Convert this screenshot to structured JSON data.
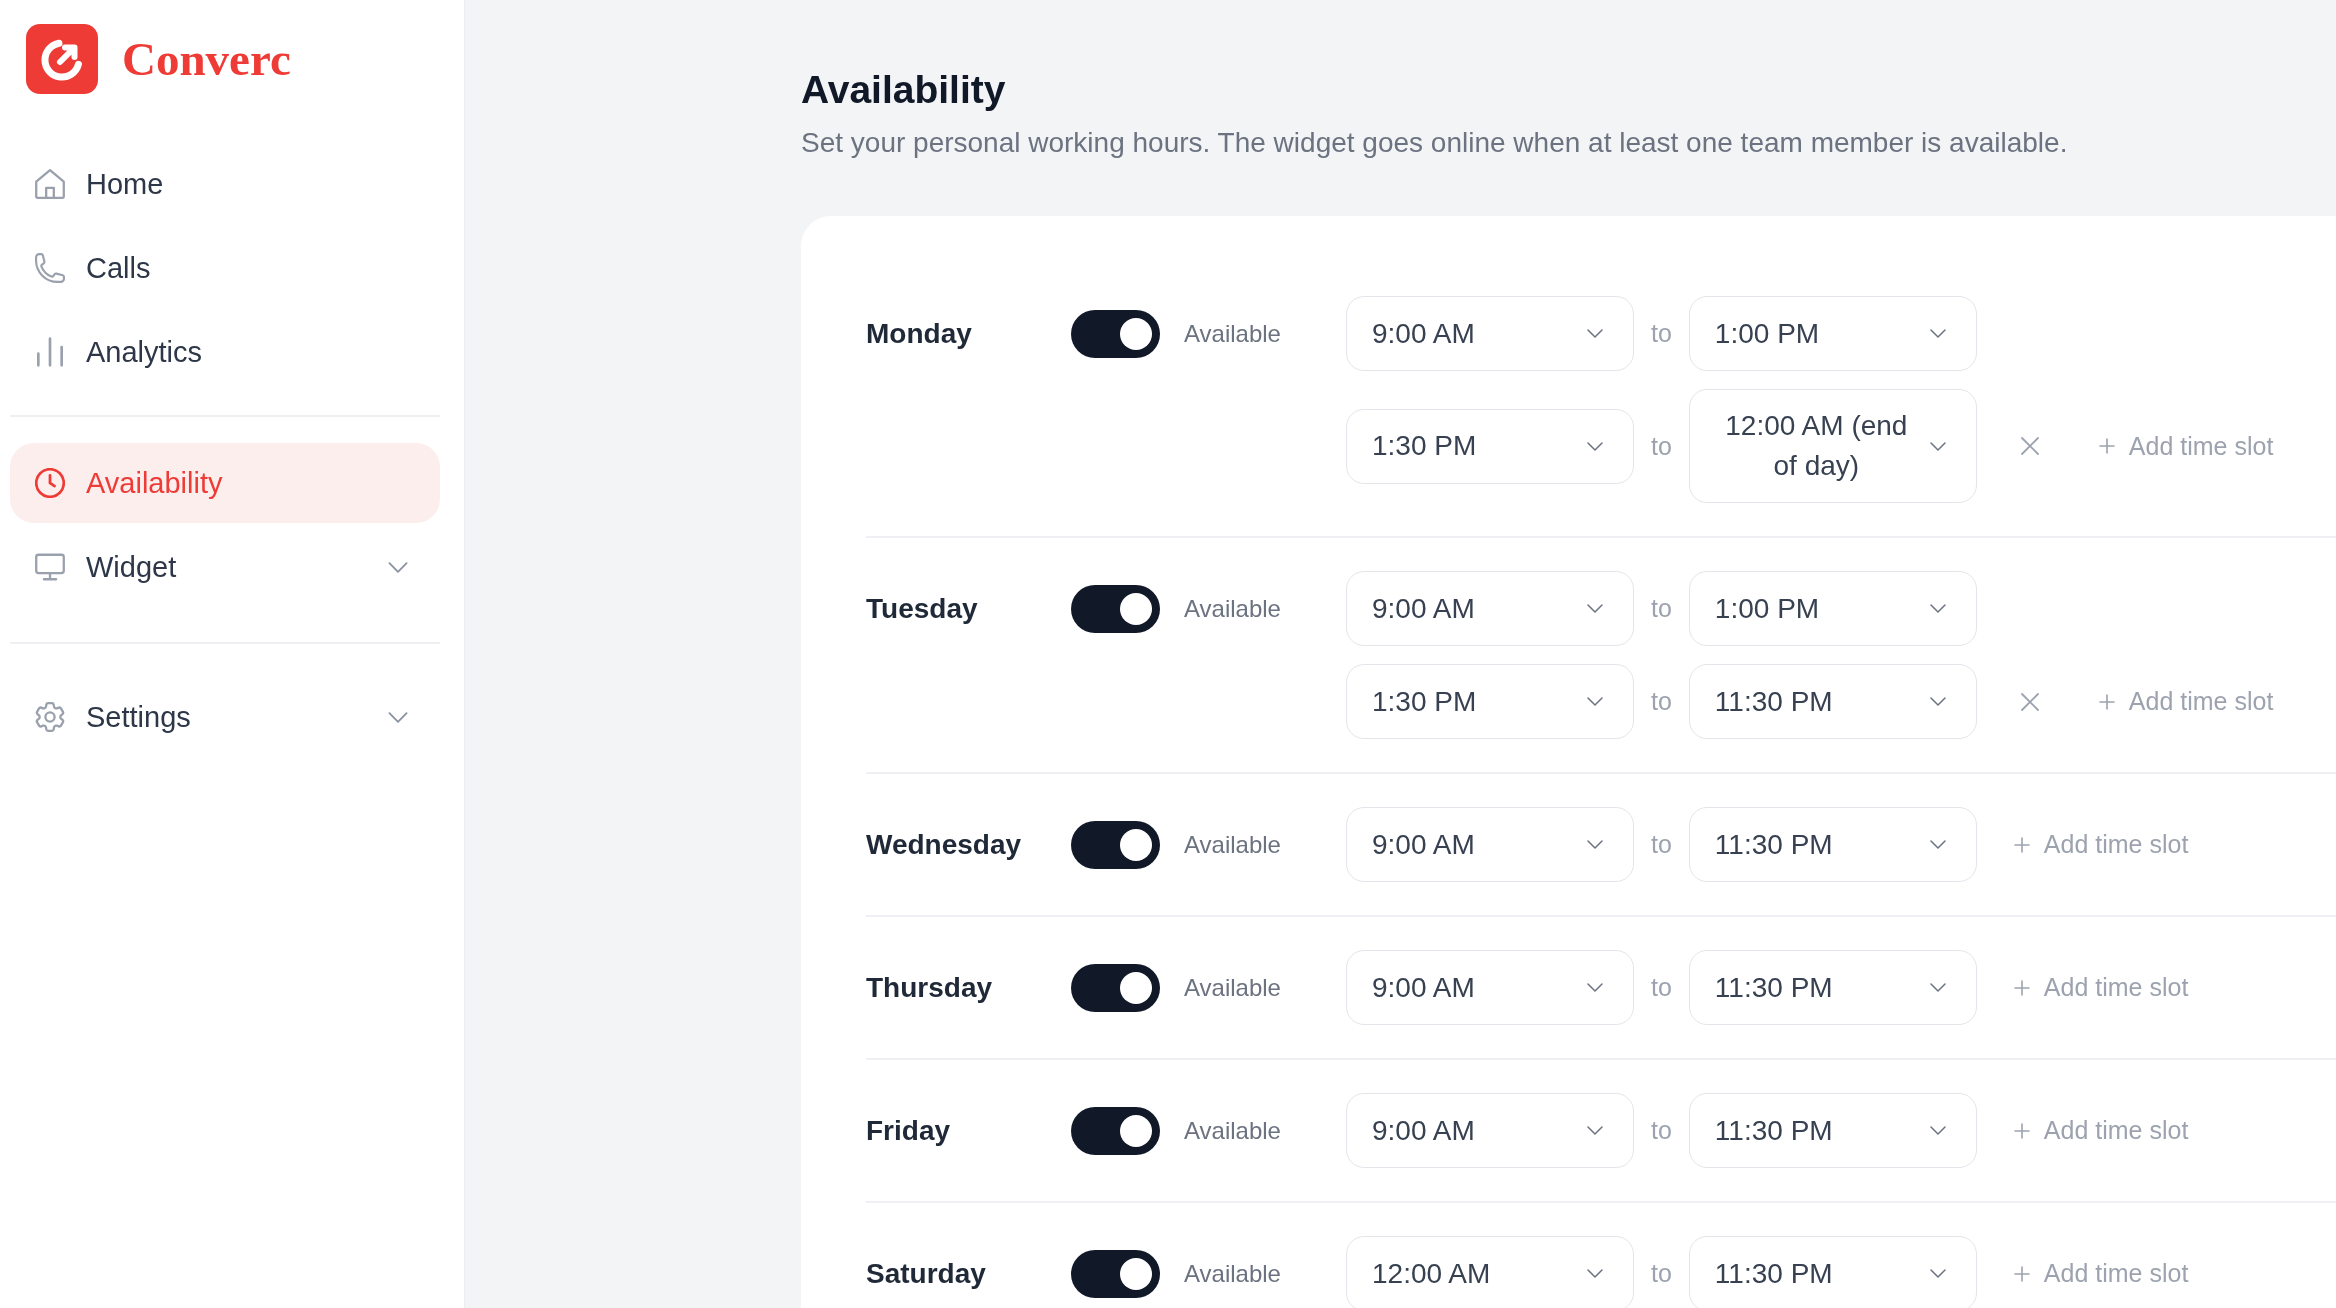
{
  "sidebar": {
    "brand": "Converc",
    "sections": [
      {
        "items": [
          {
            "label": "Home",
            "kind": "link",
            "selected": false
          },
          {
            "label": "Calls",
            "kind": "link",
            "selected": false
          },
          {
            "label": "Analytics",
            "kind": "link",
            "selected": false
          }
        ]
      },
      {
        "items": [
          {
            "label": "Availability",
            "kind": "link",
            "selected": true
          },
          {
            "label": "Widget",
            "kind": "group",
            "selected": false,
            "expanded": false
          }
        ]
      },
      {
        "items": [
          {
            "label": "Settings",
            "kind": "group",
            "selected": false,
            "expanded": false
          }
        ]
      }
    ]
  },
  "page": {
    "title": "Availability",
    "subtitle": "Set your personal working hours. The widget goes online when at least one team member is available."
  },
  "schedule": {
    "days": [
      {
        "name": "Monday",
        "available": true,
        "status_label": "Available",
        "add_label": "Add time slot",
        "slots": [
          {
            "start": "9:00 AM",
            "separator": "to",
            "end": "1:00 PM",
            "removable": false
          },
          {
            "start": "1:30 PM",
            "separator": "to",
            "end": "12:00 AM (end of day)",
            "removable": true
          }
        ]
      },
      {
        "name": "Tuesday",
        "available": true,
        "status_label": "Available",
        "add_label": "Add time slot",
        "slots": [
          {
            "start": "9:00 AM",
            "separator": "to",
            "end": "1:00 PM",
            "removable": false
          },
          {
            "start": "1:30 PM",
            "separator": "to",
            "end": "11:30 PM",
            "removable": true
          }
        ]
      },
      {
        "name": "Wednesday",
        "available": true,
        "status_label": "Available",
        "add_label": "Add time slot",
        "slots": [
          {
            "start": "9:00 AM",
            "separator": "to",
            "end": "11:30 PM",
            "removable": false
          }
        ]
      },
      {
        "name": "Thursday",
        "available": true,
        "status_label": "Available",
        "add_label": "Add time slot",
        "slots": [
          {
            "start": "9:00 AM",
            "separator": "to",
            "end": "11:30 PM",
            "removable": false
          }
        ]
      },
      {
        "name": "Friday",
        "available": true,
        "status_label": "Available",
        "add_label": "Add time slot",
        "slots": [
          {
            "start": "9:00 AM",
            "separator": "to",
            "end": "11:30 PM",
            "removable": false
          }
        ]
      },
      {
        "name": "Saturday",
        "available": true,
        "status_label": "Available",
        "add_label": "Add time slot",
        "slots": [
          {
            "start": "12:00 AM",
            "separator": "to",
            "end": "11:30 PM",
            "removable": false
          }
        ]
      }
    ]
  }
}
